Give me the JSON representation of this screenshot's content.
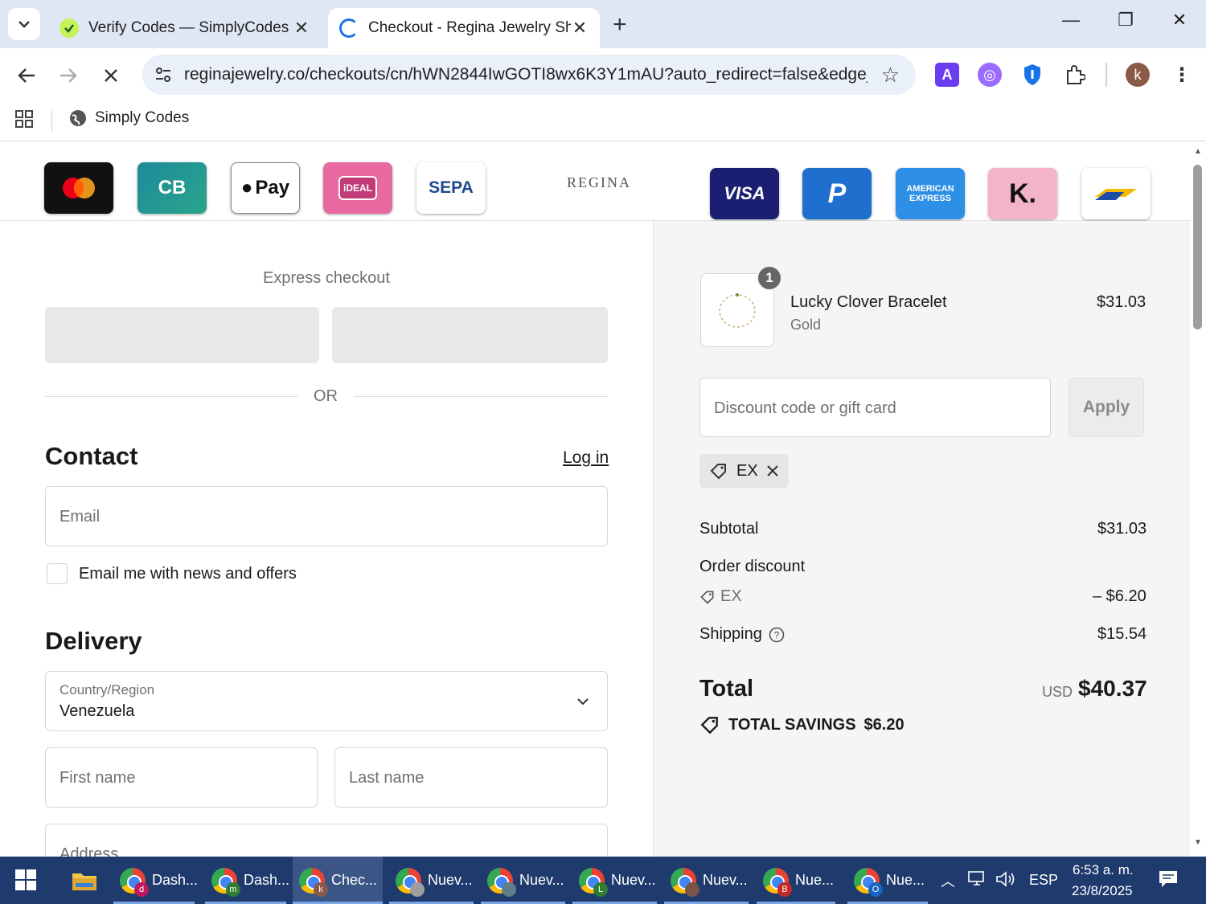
{
  "browser": {
    "tabs": [
      {
        "title": "Verify Codes — SimplyCodes",
        "active": false
      },
      {
        "title": "Checkout - Regina Jewelry Shop",
        "active": true
      }
    ],
    "url": "reginajewelry.co/checkouts/cn/hWN2844IwGOTI8wx6K3Y1mAU?auto_redirect=false&edge_...",
    "avatar_letter": "k",
    "bookmarks": [
      {
        "label": "Simply Codes"
      }
    ]
  },
  "header": {
    "brand": "REGINA",
    "payment_logos": [
      {
        "name": "mastercard",
        "label": ""
      },
      {
        "name": "cartes-bancaires",
        "label": "CB"
      },
      {
        "name": "apple-pay",
        "label": "Pay"
      },
      {
        "name": "ideal",
        "label": "iDEAL"
      },
      {
        "name": "sepa",
        "label": "SEPA"
      },
      {
        "name": "visa",
        "label": "VISA"
      },
      {
        "name": "paypal",
        "label": "P"
      },
      {
        "name": "american-express",
        "label": "AMERICAN EXPRESS"
      },
      {
        "name": "klarna",
        "label": "K."
      },
      {
        "name": "bancontact",
        "label": ""
      }
    ]
  },
  "checkout": {
    "express_label": "Express checkout",
    "or_label": "OR",
    "contact": {
      "heading": "Contact",
      "login_label": "Log in",
      "email_placeholder": "Email",
      "news_label": "Email me with news and offers"
    },
    "delivery": {
      "heading": "Delivery",
      "country_label": "Country/Region",
      "country_value": "Venezuela",
      "first_name_placeholder": "First name",
      "last_name_placeholder": "Last name",
      "address_placeholder": "Address"
    }
  },
  "summary": {
    "item": {
      "name": "Lucky Clover Bracelet",
      "variant": "Gold",
      "price": "$31.03",
      "quantity": "1"
    },
    "discount_placeholder": "Discount code or gift card",
    "apply_label": "Apply",
    "applied_code": "EX",
    "subtotal_label": "Subtotal",
    "subtotal_value": "$31.03",
    "order_discount_label": "Order discount",
    "discount_code": "EX",
    "discount_value": "– $6.20",
    "shipping_label": "Shipping",
    "shipping_value": "$15.54",
    "total_label": "Total",
    "currency": "USD",
    "total_value": "$40.37",
    "savings_label": "TOTAL SAVINGS",
    "savings_value": "$6.20"
  },
  "taskbar": {
    "items": [
      {
        "label": "Dash...",
        "profile": "d",
        "profile_color": "#c2185b"
      },
      {
        "label": "Dash...",
        "profile": "m",
        "profile_color": "#2e7d32"
      },
      {
        "label": "Chec...",
        "profile": "k",
        "profile_color": "#8b5a46"
      },
      {
        "label": "Nuev...",
        "profile": "",
        "profile_color": "#9e9e9e"
      },
      {
        "label": "Nuev...",
        "profile": "",
        "profile_color": "#607d8b"
      },
      {
        "label": "Nuev...",
        "profile": "L",
        "profile_color": "#2e7d32"
      },
      {
        "label": "Nuev...",
        "profile": "",
        "profile_color": "#795548"
      },
      {
        "label": "Nue...",
        "profile": "B",
        "profile_color": "#c62828"
      },
      {
        "label": "Nue...",
        "profile": "O",
        "profile_color": "#1565c0"
      }
    ],
    "language": "ESP",
    "time": "6:53 a. m.",
    "date": "23/8/2025"
  }
}
